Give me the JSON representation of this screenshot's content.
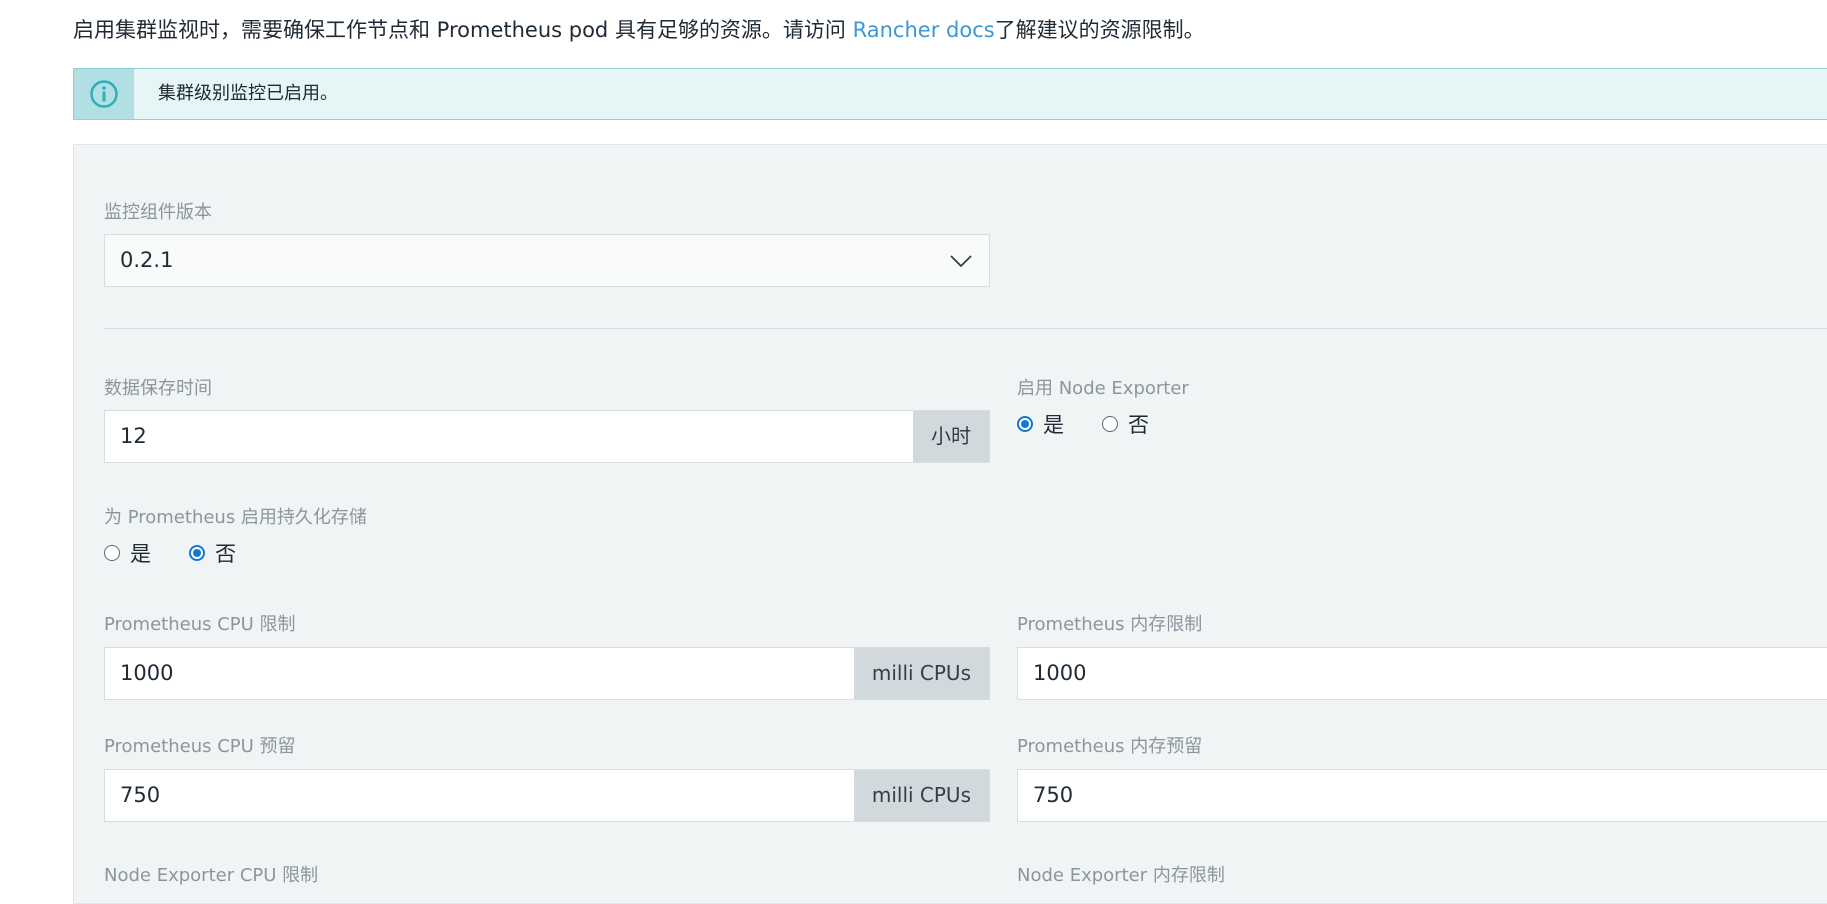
{
  "intro": {
    "text_before": "启用集群监视时，需要确保工作节点和 Prometheus pod 具有足够的资源。请访问 ",
    "link": "Rancher docs",
    "text_after": "了解建议的资源限制。"
  },
  "banner": {
    "message": "集群级别监控已启用。",
    "icon": "info-icon",
    "color": "#2bb0b6"
  },
  "form": {
    "version": {
      "label": "监控组件版本",
      "value": "0.2.1"
    },
    "retention": {
      "label": "数据保存时间",
      "value": "12",
      "unit": "小时"
    },
    "node_exporter": {
      "label": "启用 Node Exporter",
      "yes": "是",
      "no": "否",
      "selected": "yes"
    },
    "persistent": {
      "label": "为 Prometheus 启用持久化存储",
      "yes": "是",
      "no": "否",
      "selected": "no"
    },
    "cpu_limit": {
      "label": "Prometheus CPU 限制",
      "value": "1000",
      "unit": "milli CPUs"
    },
    "mem_limit": {
      "label": "Prometheus 内存限制",
      "value": "1000"
    },
    "cpu_reserve": {
      "label": "Prometheus CPU 预留",
      "value": "750",
      "unit": "milli CPUs"
    },
    "mem_reserve": {
      "label": "Prometheus 内存预留",
      "value": "750"
    },
    "ne_cpu_limit": {
      "label": "Node Exporter CPU 限制"
    },
    "ne_mem_limit": {
      "label": "Node Exporter 内存限制"
    }
  },
  "colors": {
    "accent": "#1577d5",
    "link": "#3d98d3"
  }
}
